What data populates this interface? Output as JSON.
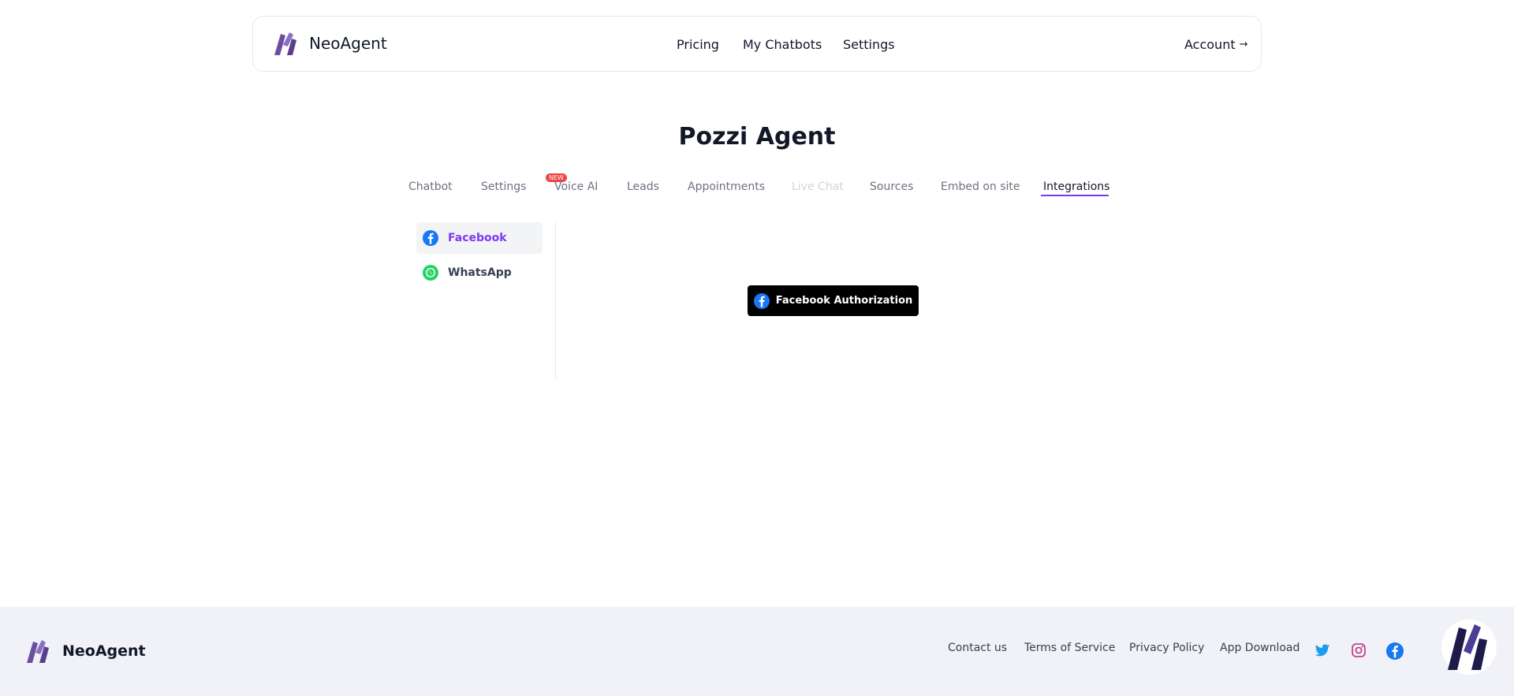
{
  "header": {
    "brand": "NeoAgent",
    "nav": {
      "pricing": "Pricing",
      "my_chatbots": "My Chatbots",
      "settings": "Settings"
    },
    "account": "Account",
    "account_arrow": "→"
  },
  "page_title": "Pozzi Agent",
  "tabs": [
    {
      "label": "Chatbot"
    },
    {
      "label": "Settings"
    },
    {
      "label": "Voice AI",
      "badge": "NEW"
    },
    {
      "label": "Leads"
    },
    {
      "label": "Appointments"
    },
    {
      "label": "Live Chat",
      "state": "disabled"
    },
    {
      "label": "Sources"
    },
    {
      "label": "Embed on site"
    },
    {
      "label": "Integrations",
      "state": "active"
    }
  ],
  "integrations": {
    "items": [
      {
        "label": "Facebook",
        "icon": "facebook-icon",
        "selected": true
      },
      {
        "label": "WhatsApp",
        "icon": "whatsapp-icon"
      }
    ],
    "facebook_auth_button": "Facebook Authorization"
  },
  "footer": {
    "brand": "NeoAgent",
    "links": [
      "Contact us",
      "Terms of Service",
      "Privacy Policy",
      "App Download"
    ],
    "social_icons": [
      "twitter-icon",
      "instagram-icon",
      "facebook-icon"
    ]
  },
  "colors": {
    "accent": "#7c3aed",
    "active_item_text": "#7e3af2",
    "badge_new": "#ef4444",
    "facebook_blue": "#1877f2",
    "whatsapp_green": "#25d366",
    "twitter_blue": "#1d9bf0",
    "instagram_pink": "#c13584",
    "footer_bg": "#f0f2f7"
  }
}
